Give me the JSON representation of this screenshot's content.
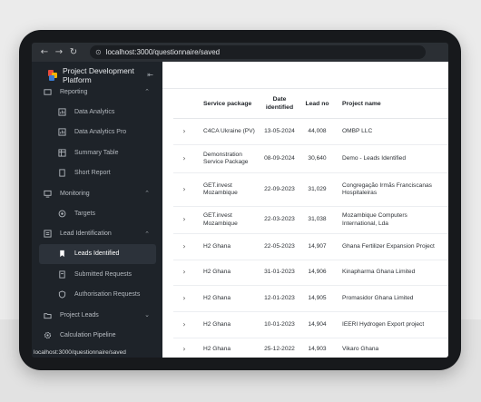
{
  "browser": {
    "back_icon": "←",
    "forward_icon": "→",
    "reload_icon": "↻",
    "site_icon": "⊙",
    "url": "localhost:3000/questionnaire/saved"
  },
  "sidebar": {
    "brand": "Project Development Platform",
    "collapse_icon": "⇤",
    "status_url": "localhost:3000/questionnaire/saved",
    "sections": {
      "reporting": {
        "label": "Reporting",
        "chevron": "⌃"
      },
      "monitoring": {
        "label": "Monitoring",
        "chevron": "⌃"
      },
      "lead_identification": {
        "label": "Lead Identification",
        "chevron": "⌃"
      },
      "project_leads": {
        "label": "Project Leads",
        "chevron": "⌄"
      }
    },
    "items": {
      "data_analytics": "Data Analytics",
      "data_analytics_pro": "Data Analytics Pro",
      "summary_table": "Summary Table",
      "short_report": "Short Report",
      "targets": "Targets",
      "leads_identified": "Leads Identified",
      "submitted_requests": "Submitted Requests",
      "authorisation_requests": "Authorisation Requests",
      "calculation_pipeline": "Calculation Pipeline"
    }
  },
  "table": {
    "headers": {
      "service_package": "Service package",
      "date_identified": "Date identified",
      "lead_no": "Lead no",
      "project_name": "Project name"
    },
    "expand_icon": "›",
    "rows": [
      {
        "service": "C4CA Ukraine (PV)",
        "date": "13-05-2024",
        "lead": "44,008",
        "project": "OMBP LLC"
      },
      {
        "service": "Demonstration Service Package",
        "date": "08-09-2024",
        "lead": "30,640",
        "project": "Demo - Leads Identified"
      },
      {
        "service": "GET.invest Mozambique",
        "date": "22-09-2023",
        "lead": "31,029",
        "project": "Congregação Irmãs Franciscanas Hospitaleiras"
      },
      {
        "service": "GET.invest Mozambique",
        "date": "22-03-2023",
        "lead": "31,038",
        "project": "Mozambique Computers International, Lda"
      },
      {
        "service": "H2 Ghana",
        "date": "22-05-2023",
        "lead": "14,907",
        "project": "Ghana Fertilizer Expansion Project"
      },
      {
        "service": "H2 Ghana",
        "date": "31-01-2023",
        "lead": "14,906",
        "project": "Kinapharma Ghana Limited"
      },
      {
        "service": "H2 Ghana",
        "date": "12-01-2023",
        "lead": "14,905",
        "project": "Promasidor Ghana Limited"
      },
      {
        "service": "H2 Ghana",
        "date": "10-01-2023",
        "lead": "14,904",
        "project": "IEERI Hydrogen Export project"
      },
      {
        "service": "H2 Ghana",
        "date": "25-12-2022",
        "lead": "14,903",
        "project": "Vikaro Ghana"
      }
    ]
  }
}
